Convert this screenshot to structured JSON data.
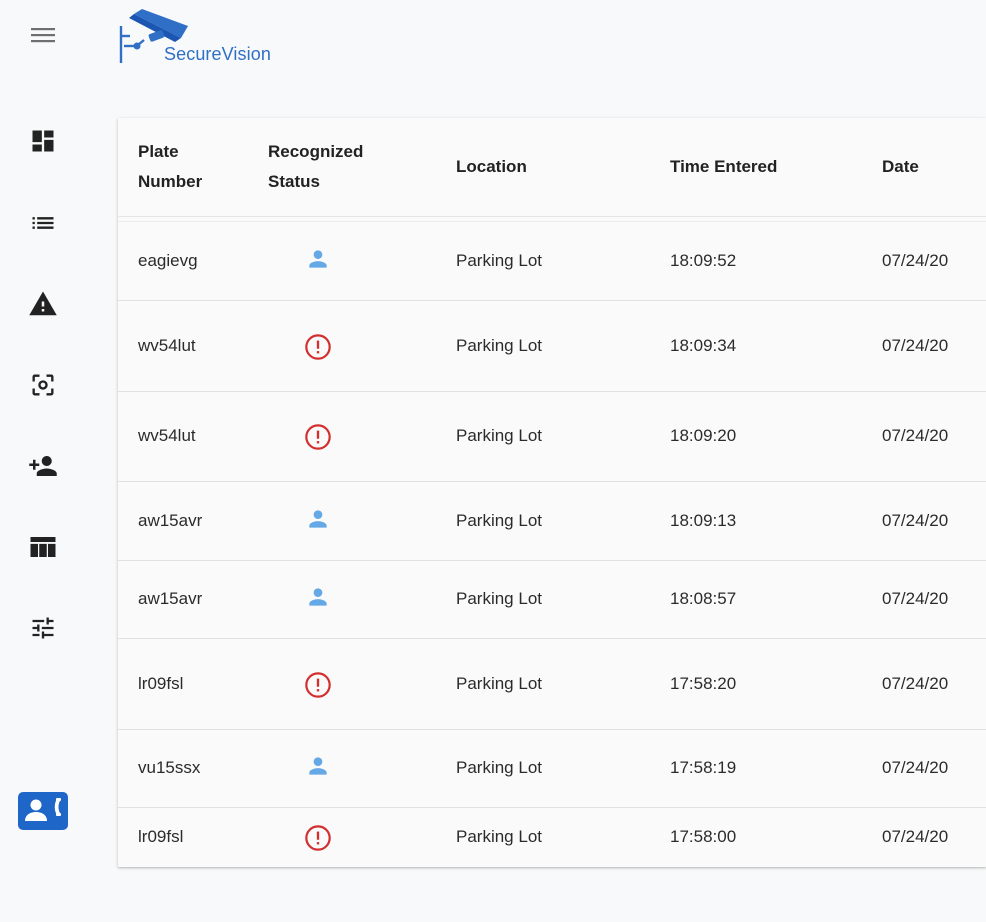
{
  "app": {
    "brand_name": "SecureVision"
  },
  "icons": {
    "menu": "menu-icon",
    "logo": "security-camera-logo-icon",
    "sidebar": [
      "dashboard-icon",
      "list-icon",
      "warning-icon",
      "camera-focus-icon",
      "person-add-icon",
      "table-icon",
      "tune-icon",
      "contact-phone-icon"
    ],
    "status_known": "person-icon",
    "status_alert": "error-outline-icon"
  },
  "colors": {
    "brand": "#2f6fc6",
    "active_nav": "#1e66c7",
    "known_status": "#64a8e6",
    "alert_status": "#d32f2f"
  },
  "table": {
    "columns": [
      {
        "key": "plate",
        "label": "Plate\nNumber"
      },
      {
        "key": "status",
        "label": "Recognized\nStatus"
      },
      {
        "key": "location",
        "label": "Location"
      },
      {
        "key": "time",
        "label": "Time Entered"
      },
      {
        "key": "date",
        "label": "Date"
      }
    ],
    "rows": [
      {
        "plate": "eagievg",
        "status": "known",
        "location": "Parking Lot",
        "time": "18:09:52",
        "date": "07/24/20"
      },
      {
        "plate": "wv54lut",
        "status": "alert",
        "location": "Parking Lot",
        "time": "18:09:34",
        "date": "07/24/20"
      },
      {
        "plate": "wv54lut",
        "status": "alert",
        "location": "Parking Lot",
        "time": "18:09:20",
        "date": "07/24/20"
      },
      {
        "plate": "aw15avr",
        "status": "known",
        "location": "Parking Lot",
        "time": "18:09:13",
        "date": "07/24/20"
      },
      {
        "plate": "aw15avr",
        "status": "known",
        "location": "Parking Lot",
        "time": "18:08:57",
        "date": "07/24/20"
      },
      {
        "plate": "lr09fsl",
        "status": "alert",
        "location": "Parking Lot",
        "time": "17:58:20",
        "date": "07/24/20"
      },
      {
        "plate": "vu15ssx",
        "status": "known",
        "location": "Parking Lot",
        "time": "17:58:19",
        "date": "07/24/20"
      },
      {
        "plate": "lr09fsl",
        "status": "alert",
        "location": "Parking Lot",
        "time": "17:58:00",
        "date": "07/24/20"
      }
    ]
  }
}
